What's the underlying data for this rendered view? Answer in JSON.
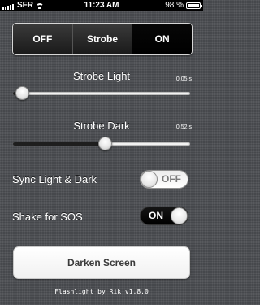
{
  "status_bar": {
    "carrier": "SFR",
    "time": "11:23 AM",
    "battery_percent": "98 %",
    "battery_level": 0.98
  },
  "strobe_mode": {
    "options": [
      "OFF",
      "Strobe",
      "ON"
    ],
    "selected": "ON"
  },
  "strobe_light": {
    "label": "Strobe Light",
    "value_text": "0.05 s",
    "level": 0.05
  },
  "strobe_dark": {
    "label": "Strobe Dark",
    "value_text": "0.52 s",
    "level": 0.52
  },
  "sync": {
    "label": "Sync Light & Dark",
    "state_text": "OFF",
    "on": false
  },
  "shake": {
    "label": "Shake for SOS",
    "state_text": "ON",
    "on": true
  },
  "darken_button": {
    "label": "Darken Screen"
  },
  "footer": "Flashlight by Rik v1.8.0"
}
